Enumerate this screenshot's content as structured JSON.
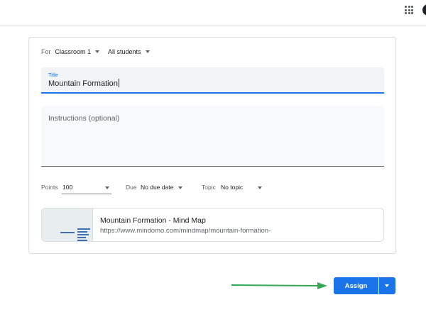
{
  "for_row": {
    "label": "For",
    "class": "Classroom 1",
    "students": "All students"
  },
  "title_field": {
    "label": "Title",
    "value": "Mountain Formation"
  },
  "instructions": {
    "placeholder": "Instructions (optional)"
  },
  "options": {
    "points_label": "Points",
    "points_value": "100",
    "due_label": "Due",
    "due_value": "No due date",
    "topic_label": "Topic",
    "topic_value": "No topic"
  },
  "attachment": {
    "title": "Mountain Formation - Mind Map",
    "url": "https://www.mindomo.com/mindmap/mountain-formation-"
  },
  "actions": {
    "assign_label": "Assign"
  },
  "colors": {
    "accent": "#1a73e8",
    "annotation_arrow": "#34a853"
  },
  "icons": {
    "apps": "apps-grid-icon",
    "dropdown": "caret-down-icon",
    "annotation": "arrow-right-icon"
  }
}
